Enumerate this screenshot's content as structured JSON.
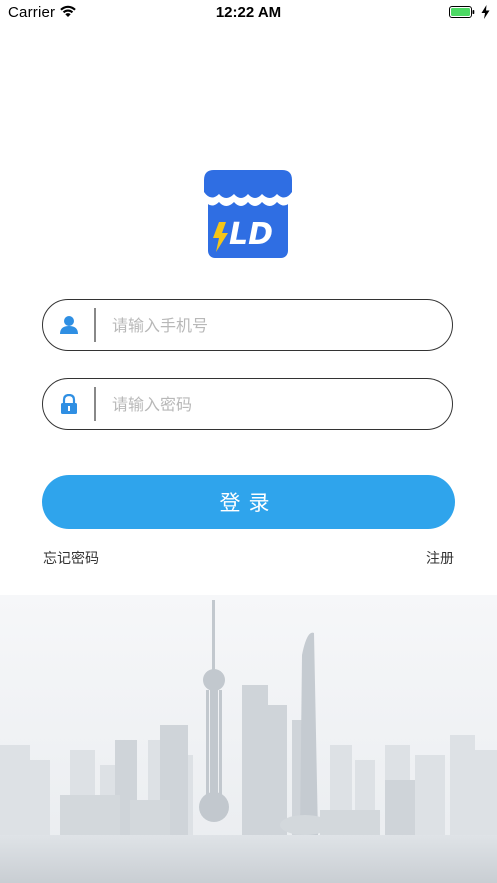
{
  "status_bar": {
    "carrier": "Carrier",
    "time": "12:22 AM"
  },
  "logo": {
    "text": "LD",
    "brand_color": "#2f6ee3",
    "bolt_color": "#f5c518"
  },
  "form": {
    "phone_placeholder": "请输入手机号",
    "password_placeholder": "请输入密码",
    "login_label": "登录",
    "forgot_password_label": "忘记密码",
    "register_label": "注册"
  },
  "colors": {
    "accent": "#2fa4ec",
    "field_border": "#333333",
    "placeholder": "#b8b8b8"
  }
}
